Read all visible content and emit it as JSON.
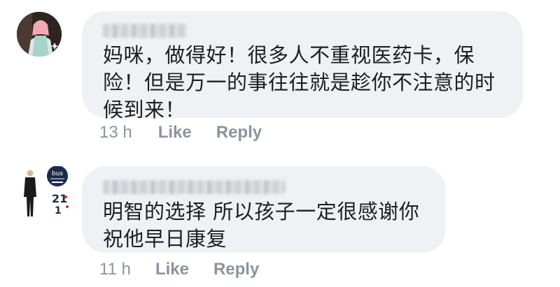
{
  "comments": [
    {
      "text_lines": [
        "妈咪，做得好！很多人不重视医药卡，保",
        "险！但是万一的事往往就是趁你不注意的时",
        "候到来！"
      ],
      "time": "13 h",
      "like_label": "Like",
      "reply_label": "Reply"
    },
    {
      "text_lines": [
        "明智的选择 所以孩子一定很感谢你",
        "祝他早日康复"
      ],
      "time": "11 h",
      "like_label": "Like",
      "reply_label": "Reply"
    }
  ],
  "colors": {
    "bubble": "#f0f1f4",
    "text": "#1c1e21",
    "meta": "#8d949e"
  }
}
